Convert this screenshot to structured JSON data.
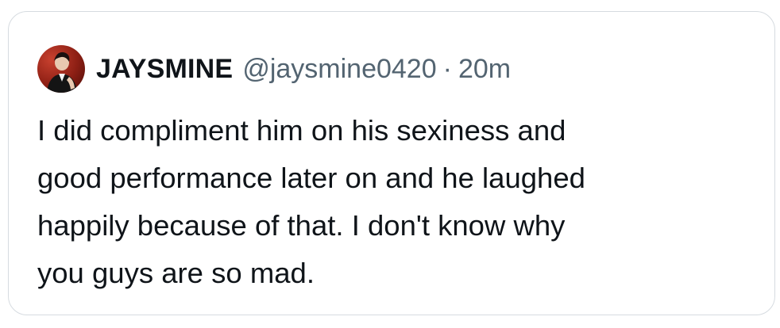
{
  "quote": {
    "author": {
      "display_name": "JAYSMINE",
      "handle": "@jaysmine0420",
      "separator": "·",
      "timestamp": "20m",
      "avatar_icon": "profile-photo-avatar"
    },
    "text": "I did compliment him on his sexiness and\ngood performance later on and he laughed\nhappily because of that. I don't know why\nyou guys are so mad."
  },
  "colors": {
    "text_primary": "#0f1419",
    "text_secondary": "#536471",
    "card_border": "#d6dbe0",
    "background": "#ffffff"
  }
}
